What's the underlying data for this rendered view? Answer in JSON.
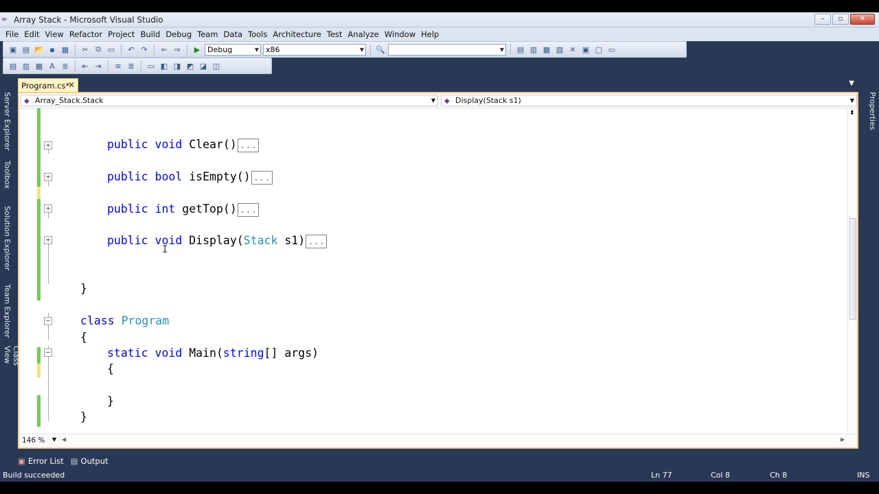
{
  "window": {
    "title": "Array Stack - Microsoft Visual Studio",
    "buttons": [
      "–",
      "▫",
      "✕"
    ]
  },
  "menu": [
    "File",
    "Edit",
    "View",
    "Refactor",
    "Project",
    "Build",
    "Debug",
    "Team",
    "Data",
    "Tools",
    "Architecture",
    "Test",
    "Analyze",
    "Window",
    "Help"
  ],
  "toolbar": {
    "config": "Debug",
    "platform": "x86",
    "find": ""
  },
  "side_left": [
    "Server Explorer",
    "Toolbox",
    "Solution Explorer",
    "Team Explorer",
    "Class View"
  ],
  "side_right": [
    "Properties"
  ],
  "doc_tab": {
    "label": "Program.cs*",
    "close": "✕"
  },
  "nav": {
    "type_dropdown": "Array_Stack.Stack",
    "member_dropdown": "Display(Stack s1)"
  },
  "code": {
    "clear_line": {
      "kw1": "public",
      "kw2": "void",
      "name": "Clear()",
      "collapsed": "..."
    },
    "isempty_line": {
      "kw1": "public",
      "kw2": "bool",
      "name": "isEmpty()",
      "collapsed": "..."
    },
    "gettop_line": {
      "kw1": "public",
      "kw2": "int",
      "name": "getTop()",
      "collapsed": "..."
    },
    "display_line": {
      "kw1": "public",
      "kw2": "void",
      "name": "Display(",
      "type": "Stack",
      "rest": " s1)",
      "collapsed": "..."
    },
    "close_brace_1": "}",
    "class_line": {
      "kw": "class",
      "name": "Program"
    },
    "open_brace_2": "{",
    "main_line": {
      "kw1": "static",
      "kw2": "void",
      "name": "Main(",
      "kw3": "string",
      "rest": "[] args)"
    },
    "open_brace_3": "{",
    "close_brace_3": "}",
    "close_brace_2": "}",
    "close_brace_4": "}"
  },
  "editor": {
    "zoom": "146 %"
  },
  "bottom_tabs": [
    "Error List",
    "Output"
  ],
  "status": {
    "message": "Build succeeded",
    "ln": "Ln 77",
    "col": "Col 8",
    "ch": "Ch 8",
    "mode": "INS"
  },
  "colors": {
    "keyword": "#0000ff",
    "type": "#2b91af",
    "changed_saved": "#6ccf4f",
    "changed_unsaved": "#f5e37a",
    "chrome": "#293955"
  }
}
